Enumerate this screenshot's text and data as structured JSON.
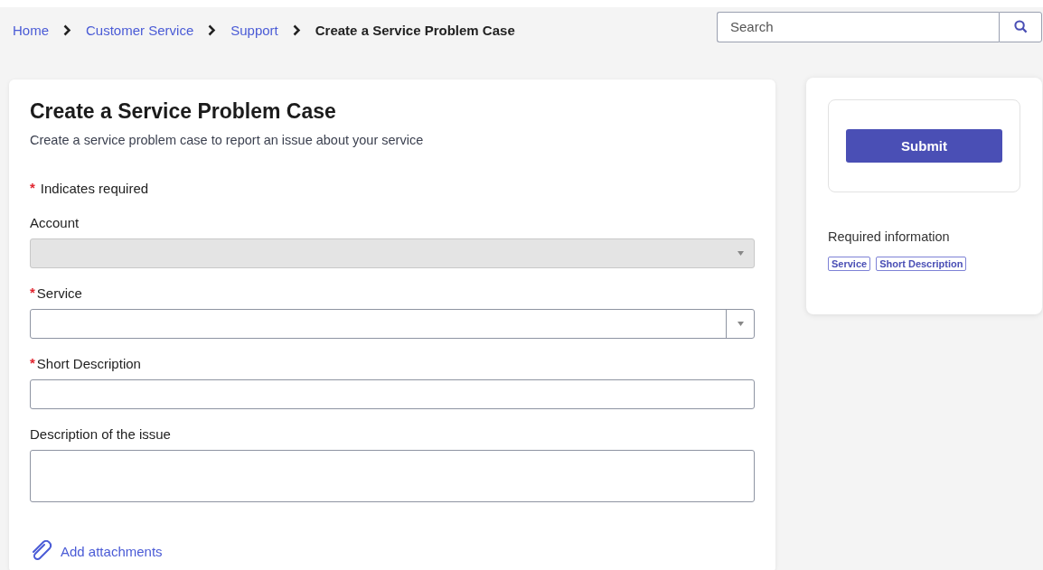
{
  "breadcrumbs": [
    {
      "label": "Home",
      "current": false
    },
    {
      "label": "Customer Service",
      "current": false
    },
    {
      "label": "Support",
      "current": false
    },
    {
      "label": "Create a Service Problem Case",
      "current": true
    }
  ],
  "search": {
    "placeholder": "Search"
  },
  "form": {
    "title": "Create a Service Problem Case",
    "subtitle": "Create a service problem case to report an issue about your service",
    "required_note": {
      "mark": "*",
      "text": "Indicates required"
    },
    "fields": [
      {
        "label": "Account",
        "kind": "select",
        "disabled": true
      },
      {
        "required_mark": "*",
        "label": "Service",
        "kind": "select",
        "disabled": false
      },
      {
        "required_mark": "*",
        "label": "Short Description",
        "kind": "text",
        "disabled": false
      },
      {
        "label": "Description of the issue",
        "kind": "textarea",
        "disabled": false
      }
    ],
    "attachments_link": "Add attachments"
  },
  "sidebar": {
    "submit": "Submit",
    "required_heading": "Required information",
    "required_tags": [
      "Service",
      "Short Description"
    ]
  }
}
